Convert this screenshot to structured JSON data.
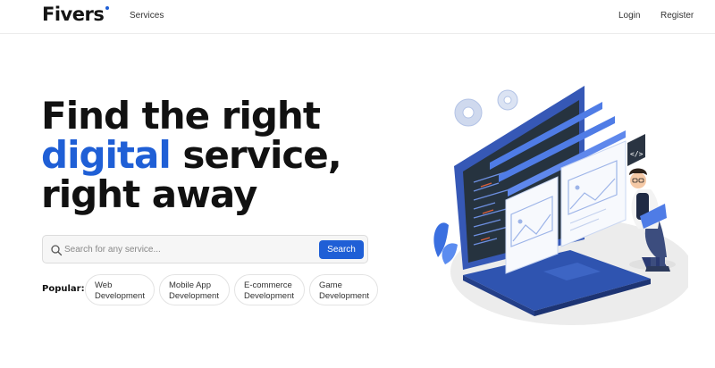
{
  "brand": {
    "name": "Fivers",
    "accent_color": "#1f5fd6"
  },
  "nav": {
    "services": "Services",
    "login": "Login",
    "register": "Register"
  },
  "hero": {
    "line1": "Find the right",
    "line2_accent": "digital",
    "line2_rest": " service,",
    "line3": "right away"
  },
  "search": {
    "placeholder": "Search for any service...",
    "value": "",
    "button": "Search",
    "icon": "search-icon"
  },
  "popular": {
    "label": "Popular:",
    "chips": [
      {
        "line1": "Web",
        "line2": "Development"
      },
      {
        "line1": "Mobile App",
        "line2": "Development"
      },
      {
        "line1": "E-commerce",
        "line2": "Development"
      },
      {
        "line1": "Game",
        "line2": "Development"
      }
    ]
  },
  "illustration": {
    "subject": "developer with laptop sitting beside large laptop showing code windows and gears",
    "code_tag": "</>"
  }
}
